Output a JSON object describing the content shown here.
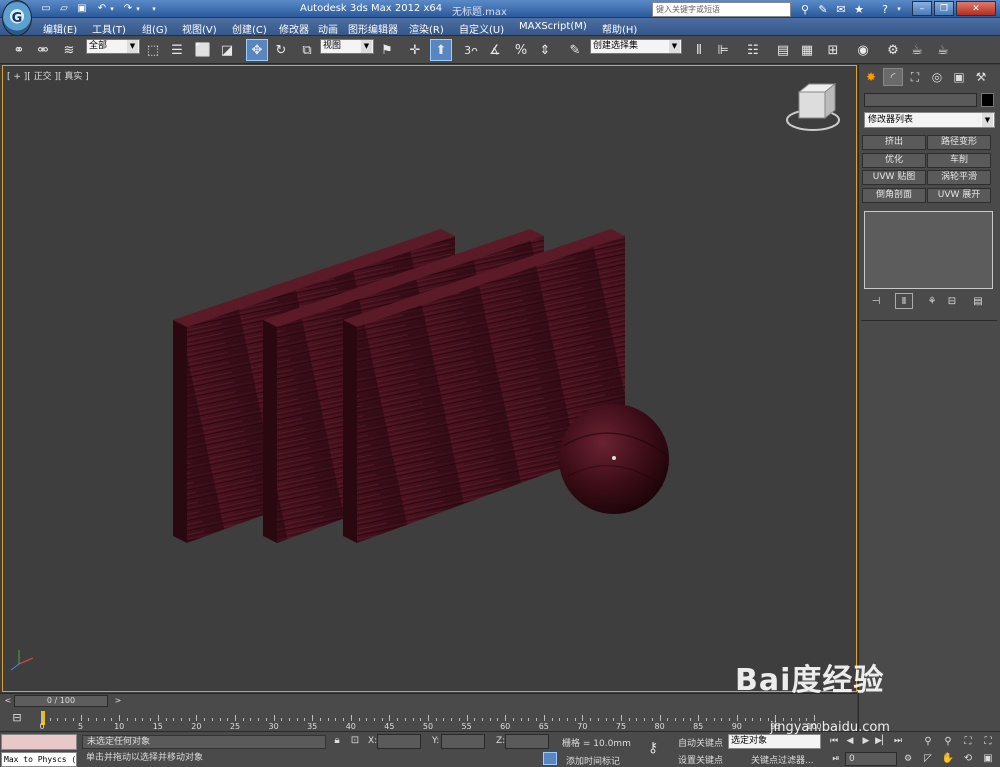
{
  "app": {
    "title": "Autodesk 3ds Max  2012 x64",
    "document": "无标题.max",
    "search_placeholder": "键入关键字或短语"
  },
  "menu": [
    "编辑(E)",
    "工具(T)",
    "组(G)",
    "视图(V)",
    "创建(C)",
    "修改器",
    "动画",
    "图形编辑器",
    "渲染(R)",
    "自定义(U)",
    "MAXScript(M)",
    "帮助(H)"
  ],
  "toolbar": {
    "filter": "全部",
    "ref_coord": "视图",
    "named_selection": "创建选择集"
  },
  "viewport": {
    "label": "[ + ][ 正交 ][ 真实 ]"
  },
  "command_panel": {
    "modifier_list": "修改器列表",
    "buttons": [
      "挤出",
      "路径变形",
      "优化",
      "车削",
      "UVW 贴图",
      "涡轮平滑",
      "倒角剖面",
      "UVW 展开"
    ]
  },
  "timeline": {
    "position": "0 / 100",
    "ticks": [
      "0",
      "5",
      "10",
      "15",
      "20",
      "25",
      "30",
      "35",
      "40",
      "45",
      "50",
      "55",
      "60",
      "65",
      "70",
      "75",
      "80",
      "85",
      "90",
      "95",
      "100"
    ]
  },
  "status": {
    "maxscript": "Max to Physcs (",
    "selection": "未选定任何对象",
    "prompt": "单击并拖动以选择并移动对象",
    "x_label": "X:",
    "y_label": "Y:",
    "z_label": "Z:",
    "grid": "栅格 = 10.0mm",
    "add_time_tag": "添加时间标记",
    "auto_key": "自动关键点",
    "set_key": "设置关键点",
    "selected": "选定对象",
    "key_filters": "关键点过滤器...",
    "frame": "0"
  },
  "watermark": {
    "brand": "Bai度经验",
    "url": "jingyan.baidu.com"
  },
  "colors": {
    "wood": "#4a1220",
    "viewport_bg": "#3e3e3e",
    "viewport_border": "#d9a42a",
    "active_blue": "#5a86c0"
  }
}
